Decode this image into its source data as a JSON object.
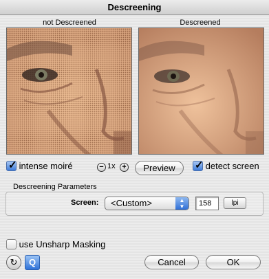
{
  "window": {
    "title": "Descreening"
  },
  "preview": {
    "left_label": "not Descreened",
    "right_label": "Descreened"
  },
  "controls": {
    "intense_moire_label": "intense moiré",
    "intense_moire_checked": true,
    "zoom_level": "1x",
    "preview_button": "Preview",
    "detect_screen_label": "detect screen",
    "detect_screen_checked": true
  },
  "parameters": {
    "group_title": "Descreening Parameters",
    "screen_label": "Screen:",
    "screen_value": "<Custom>",
    "lpi_value": "158",
    "lpi_button": "lpi"
  },
  "unsharp": {
    "label": "use Unsharp Masking",
    "checked": false
  },
  "footer": {
    "cancel_button": "Cancel",
    "ok_button": "OK"
  },
  "icons": {
    "zoom_out": "zoom-out-icon",
    "zoom_in": "zoom-in-icon",
    "reset": "reset-icon",
    "help": "help-icon"
  }
}
